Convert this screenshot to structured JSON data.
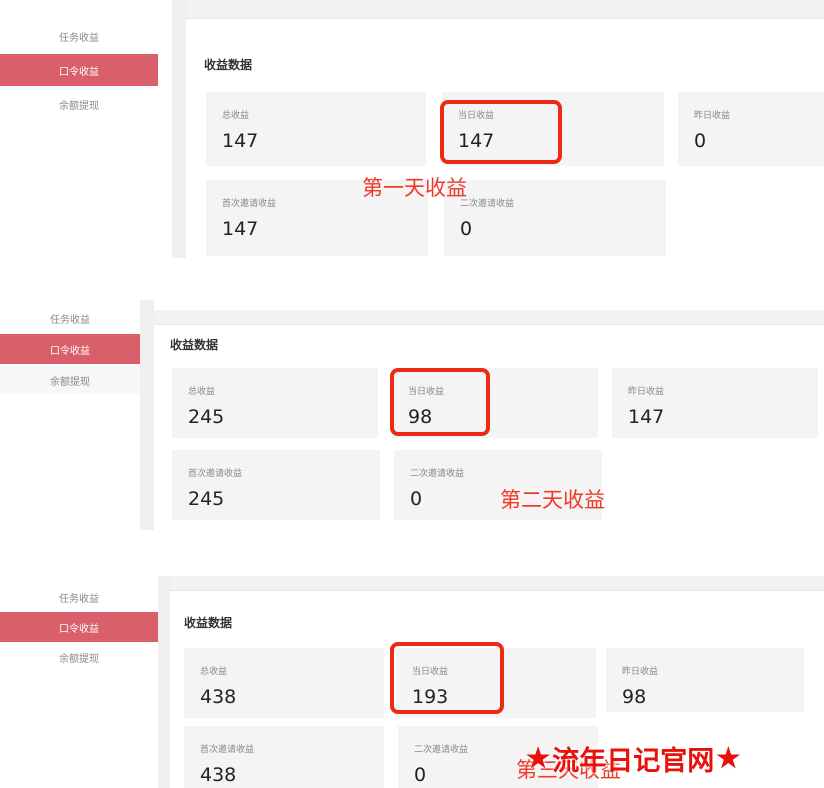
{
  "panels": [
    {
      "nav": [
        "任务收益",
        "口令收益",
        "余额提现"
      ],
      "active_index": 1,
      "section_title": "收益数据",
      "cards": [
        {
          "label": "总收益",
          "value": "147"
        },
        {
          "label": "当日收益",
          "value": "147"
        },
        {
          "label": "昨日收益",
          "value": "0"
        },
        {
          "label": "首次邀请收益",
          "value": "147"
        },
        {
          "label": "二次邀请收益",
          "value": "0"
        }
      ],
      "annotation": "第一天收益"
    },
    {
      "nav": [
        "任务收益",
        "口令收益",
        "余额提现"
      ],
      "active_index": 1,
      "section_title": "收益数据",
      "cards": [
        {
          "label": "总收益",
          "value": "245"
        },
        {
          "label": "当日收益",
          "value": "98"
        },
        {
          "label": "昨日收益",
          "value": "147"
        },
        {
          "label": "首次邀请收益",
          "value": "245"
        },
        {
          "label": "二次邀请收益",
          "value": "0"
        }
      ],
      "annotation": "第二天收益"
    },
    {
      "nav": [
        "任务收益",
        "口令收益",
        "余额提现"
      ],
      "active_index": 1,
      "section_title": "收益数据",
      "cards": [
        {
          "label": "总收益",
          "value": "438"
        },
        {
          "label": "当日收益",
          "value": "193"
        },
        {
          "label": "昨日收益",
          "value": "98"
        },
        {
          "label": "首次邀请收益",
          "value": "438"
        },
        {
          "label": "二次邀请收益",
          "value": "0"
        }
      ],
      "annotation": "第三天收益"
    }
  ],
  "watermark": {
    "text": "流年日记官网",
    "star": "★"
  },
  "colors": {
    "active_nav": "#d9606b",
    "highlight": "#ee2a14",
    "annotation": "#ee3a2a",
    "card_bg": "#f4f4f4"
  }
}
